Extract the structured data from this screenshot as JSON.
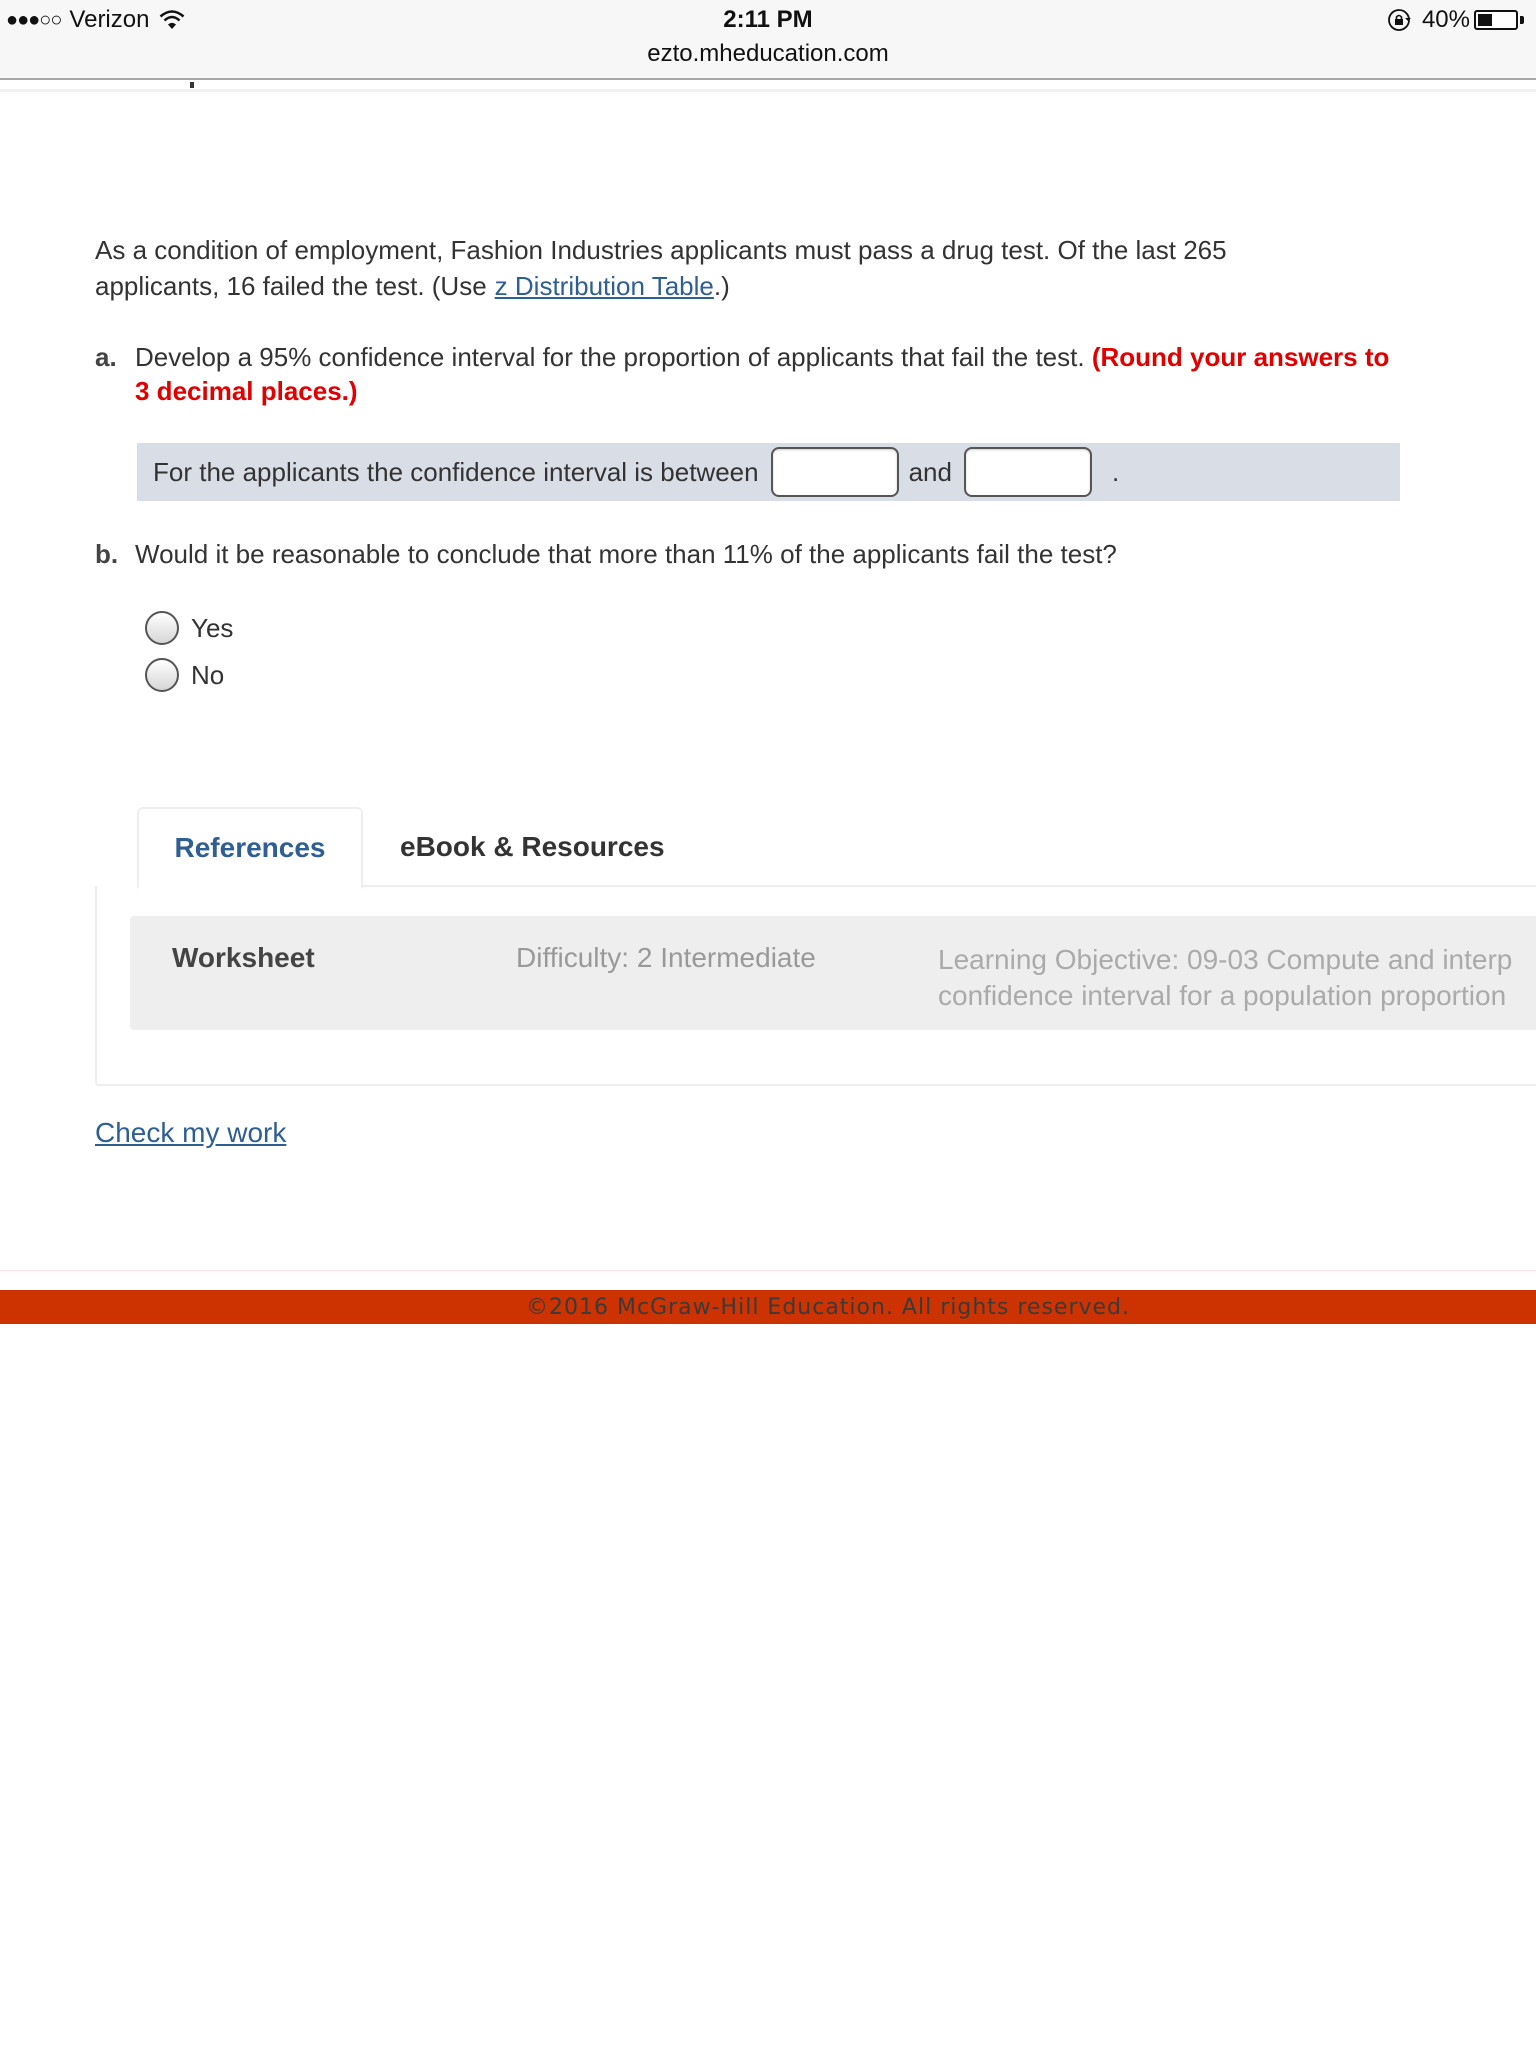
{
  "status_bar": {
    "signal": "●●●○○",
    "carrier": "Verizon",
    "time": "2:11 PM",
    "url": "ezto.mheducation.com",
    "battery_percent": "40%",
    "battery_level": 0.4,
    "icons": [
      "wifi-icon",
      "rotation-lock-icon",
      "battery-icon"
    ]
  },
  "question": {
    "intro_text": "As a condition of employment, Fashion Industries applicants must pass a drug test. Of the last 265 applicants, 16 failed the test. (Use",
    "intro_link": "z Distribution Table",
    "intro_end": ".)",
    "part_a": {
      "letter": "a.",
      "text": "Develop a 95% confidence interval for the proportion of applicants that fail the test.",
      "instruction": "(Round your answers to 3 decimal places.)",
      "answer_prefix": "For the applicants the confidence interval is between",
      "answer_and": "and",
      "answer_suffix": ".",
      "lower_value": "",
      "upper_value": ""
    },
    "part_b": {
      "letter": "b.",
      "text": "Would it be reasonable to conclude that more than 11% of the applicants fail the test?",
      "options": [
        {
          "label": "Yes",
          "selected": false
        },
        {
          "label": "No",
          "selected": false
        }
      ]
    }
  },
  "tabs": [
    {
      "label": "References",
      "active": true
    },
    {
      "label": "eBook & Resources",
      "active": false
    }
  ],
  "references": {
    "type": "Worksheet",
    "difficulty": "Difficulty: 2 Intermediate",
    "objective_line1": "Learning Objective: 09-03 Compute and interp",
    "objective_line2": "confidence interval for a population proportion"
  },
  "check_work_label": "Check my work",
  "footer": {
    "text": "©2016 McGraw-Hill Education. All rights reserved.",
    "color": "#cc3300"
  },
  "colors": {
    "link": "#2e5e92",
    "warning_red": "#e00000",
    "answer_bg": "#d9dde6"
  }
}
